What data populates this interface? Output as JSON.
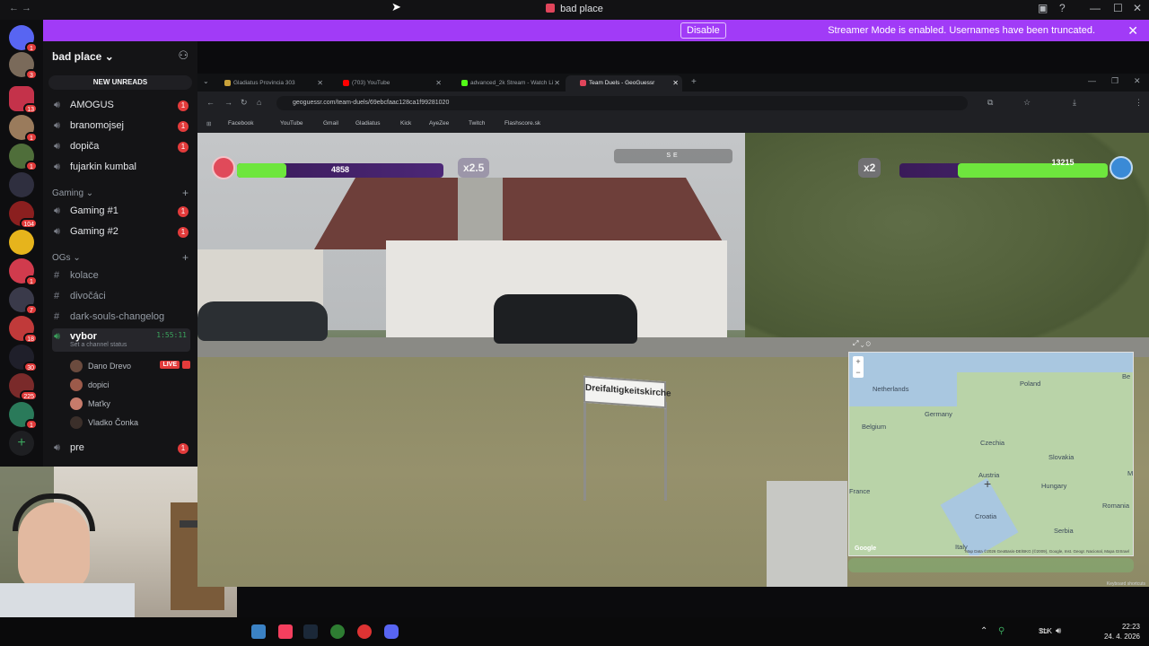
{
  "window": {
    "title": "bad place"
  },
  "banner": {
    "message": "Streamer Mode is enabled. Usernames have been truncated.",
    "disable_label": "Disable"
  },
  "rail_badges": [
    "1",
    "3",
    "13",
    "1",
    "1",
    "104",
    "1",
    "7",
    "18",
    "30",
    "225",
    "1",
    "8"
  ],
  "server": {
    "name": "bad place",
    "unreads_label": "NEW UNREADS"
  },
  "channels_top": [
    {
      "label": "AMOGUS",
      "badge": "1"
    },
    {
      "label": "branomojsej",
      "badge": "1"
    },
    {
      "label": "dopiča",
      "badge": "1"
    },
    {
      "label": "fujarkin kumbal",
      "badge": ""
    }
  ],
  "category_gaming": {
    "label": "Gaming",
    "items": [
      {
        "label": "Gaming #1",
        "badge": "1"
      },
      {
        "label": "Gaming #2",
        "badge": "1"
      }
    ]
  },
  "category_ogs": {
    "label": "OGs",
    "items": [
      {
        "label": "kolace"
      },
      {
        "label": "divočáci"
      },
      {
        "label": "dark-souls-changelog"
      }
    ]
  },
  "active_voice": {
    "label": "vybor",
    "status": "Set a channel status",
    "timer": "1:55:11"
  },
  "voice_users": [
    {
      "name": "Dano Drevo",
      "live": "LIVE"
    },
    {
      "name": "dopici",
      "live": ""
    },
    {
      "name": "Maťky",
      "live": ""
    },
    {
      "name": "Vladko Čonka",
      "live": ""
    }
  ],
  "channel_pre": {
    "label": "pre",
    "badge": "1"
  },
  "browser": {
    "tabs": [
      {
        "label": "Gladiatus Provincia 303",
        "color": "#c9a23a"
      },
      {
        "label": "(703) YouTube",
        "color": "#ff0000"
      },
      {
        "label": "advanced_2k Stream - Watch Li",
        "color": "#53fc18"
      },
      {
        "label": "Team Duels - GeoGuessr",
        "color": "#e0455b"
      }
    ],
    "url": "geoguessr.com/team-duels/69ebcfaac128ca1f99281020",
    "bookmarks": [
      "Facebook",
      "YouTube",
      "Gmail",
      "Gladiatus",
      "Kick",
      "AyeZee",
      "Twitch",
      "Flashscore.sk"
    ]
  },
  "game": {
    "left_score": "4858",
    "left_multiplier": "x2.5",
    "left_health_fraction": 0.24,
    "right_score": "13215",
    "right_multiplier": "x2",
    "right_health_fraction": 0.72,
    "compass": "SE",
    "sign_text": "Dreifaltigkeitskirche",
    "keyboard_label": "Keyboard shortcuts"
  },
  "map": {
    "labels": [
      {
        "text": "Netherlands"
      },
      {
        "text": "Germany"
      },
      {
        "text": "Poland"
      },
      {
        "text": "Belgium"
      },
      {
        "text": "Czechia"
      },
      {
        "text": "Slovakia"
      },
      {
        "text": "Austria"
      },
      {
        "text": "Hungary"
      },
      {
        "text": "Romania"
      },
      {
        "text": "Croatia"
      },
      {
        "text": "Serbia"
      },
      {
        "text": "Italy"
      },
      {
        "text": "France"
      },
      {
        "text": "Be"
      },
      {
        "text": "M"
      }
    ],
    "google": "Google",
    "attribution": "Map Data ©2026 GeoBasis-DE/BKG (©2009), Google, Inst. Geogr. Nacional, Mapa GISrael"
  },
  "tray": {
    "lang": "SLK",
    "time": "22:23",
    "date": "24. 4. 2026"
  }
}
